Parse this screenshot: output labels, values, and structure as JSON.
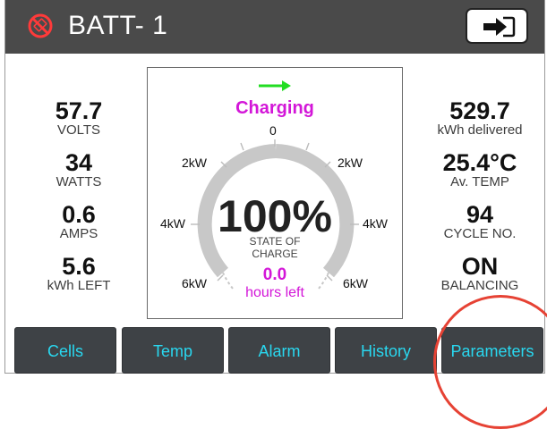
{
  "header": {
    "title": "BATT- 1",
    "battery_icon": "battery-no-sign-icon",
    "exit_icon": "exit-arrow-icon"
  },
  "left_stats": [
    {
      "value": "57.7",
      "label": "VOLTS"
    },
    {
      "value": "34",
      "label": "WATTS"
    },
    {
      "value": "0.6",
      "label": "AMPS"
    },
    {
      "value": "5.6",
      "label": "kWh LEFT"
    }
  ],
  "right_stats": [
    {
      "value": "529.7",
      "label": "kWh delivered"
    },
    {
      "value": "25.4°C",
      "label": "Av. TEMP"
    },
    {
      "value": "94",
      "label": "CYCLE NO."
    },
    {
      "value": "ON",
      "label": "BALANCING"
    }
  ],
  "gauge": {
    "status": "Charging",
    "status_icon": "arrow-right-icon",
    "soc_value": "100%",
    "soc_label_line1": "STATE OF",
    "soc_label_line2": "CHARGE",
    "hours_value": "0.0",
    "hours_label": "hours left",
    "ticks": {
      "top": "0",
      "upper_left": "2kW",
      "upper_right": "2kW",
      "mid_left": "4kW",
      "mid_right": "4kW",
      "low_left": "6kW",
      "low_right": "6kW"
    }
  },
  "nav": {
    "cells": "Cells",
    "temp": "Temp",
    "alarm": "Alarm",
    "history": "History",
    "parameters": "Parameters"
  },
  "colors": {
    "header_bg": "#4a4a4a",
    "accent_magenta": "#d316d8",
    "arrow_green": "#22dd22",
    "nav_text": "#29d8f0",
    "nav_bg": "#3e4246",
    "highlight": "#e64234"
  }
}
